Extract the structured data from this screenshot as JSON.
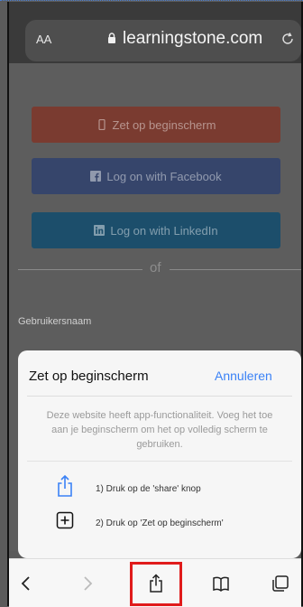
{
  "browser": {
    "text_size_label": "AA",
    "domain": "learningstone.com"
  },
  "page": {
    "add_home_button": "Zet op beginscherm",
    "facebook_button": "Log on with Facebook",
    "linkedin_button": "Log on with LinkedIn",
    "divider_text": "of",
    "username_label": "Gebruikersnaam"
  },
  "sheet": {
    "title": "Zet op beginscherm",
    "cancel": "Annuleren",
    "description": "Deze website heeft app-functionaliteit. Voeg het toe aan je beginscherm om het op volledig scherm te gebruiken.",
    "step1": "1) Druk op de 'share' knop",
    "step2": "2) Druk op 'Zet op beginscherm'"
  },
  "colors": {
    "accent": "#3b82f6",
    "highlight": "#e01b1b"
  },
  "icons": [
    "lock-icon",
    "reload-icon",
    "phone-icon",
    "facebook-icon",
    "linkedin-icon",
    "share-icon",
    "add-square-icon",
    "back-icon",
    "forward-icon",
    "bookmarks-icon",
    "tabs-icon"
  ]
}
